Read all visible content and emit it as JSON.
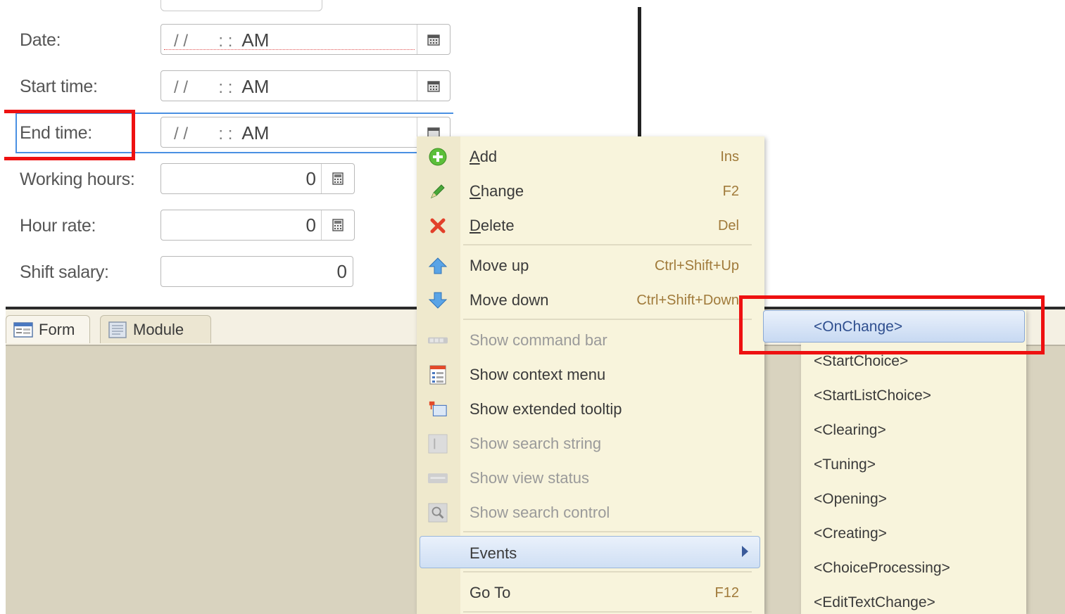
{
  "form": {
    "fields": [
      {
        "label": "Date:",
        "value": "/ /",
        "time": ": :",
        "ampm": "AM"
      },
      {
        "label": "Start time:",
        "value": "/ /",
        "time": ": :",
        "ampm": "AM"
      },
      {
        "label": "End time:",
        "value": "/ /",
        "time": ": :",
        "ampm": "AM"
      },
      {
        "label": "Working hours:",
        "value": "0"
      },
      {
        "label": "Hour rate:",
        "value": "0"
      },
      {
        "label": "Shift salary:",
        "value": "0"
      }
    ]
  },
  "tabs": [
    {
      "label": "Form"
    },
    {
      "label": "Module"
    }
  ],
  "context_menu": {
    "items": [
      {
        "label_u": "A",
        "label_rest": "dd",
        "shortcut": "Ins",
        "icon": "add-icon"
      },
      {
        "label_u": "C",
        "label_rest": "hange",
        "shortcut": "F2",
        "icon": "pencil-icon"
      },
      {
        "label_u": "D",
        "label_rest": "elete",
        "shortcut": "Del",
        "icon": "delete-icon"
      },
      {
        "label": "Move up",
        "shortcut": "Ctrl+Shift+Up",
        "icon": "arrow-up-icon"
      },
      {
        "label": "Move down",
        "shortcut": "Ctrl+Shift+Down",
        "icon": "arrow-down-icon"
      },
      {
        "label": "Show command bar",
        "icon": "command-bar-icon",
        "disabled": true
      },
      {
        "label": "Show context menu",
        "icon": "context-menu-icon"
      },
      {
        "label": "Show extended tooltip",
        "icon": "tooltip-icon"
      },
      {
        "label": "Show search string",
        "icon": "search-string-icon",
        "disabled": true
      },
      {
        "label": "Show view status",
        "icon": "view-status-icon",
        "disabled": true
      },
      {
        "label": "Show search control",
        "icon": "search-control-icon",
        "disabled": true
      },
      {
        "label": "Events",
        "icon": "",
        "submenu": true
      },
      {
        "label": "Go To",
        "shortcut": "F12"
      }
    ]
  },
  "events_submenu": [
    "<OnChange>",
    "<StartChoice>",
    "<StartListChoice>",
    "<Clearing>",
    "<Tuning>",
    "<Opening>",
    "<Creating>",
    "<ChoiceProcessing>",
    "<EditTextChange>"
  ],
  "colors": {
    "highlight_red": "#ee1111",
    "focus_blue": "#4a90e2",
    "menu_bg": "#f8f4dc",
    "panel_bg": "#d9d3bf"
  }
}
